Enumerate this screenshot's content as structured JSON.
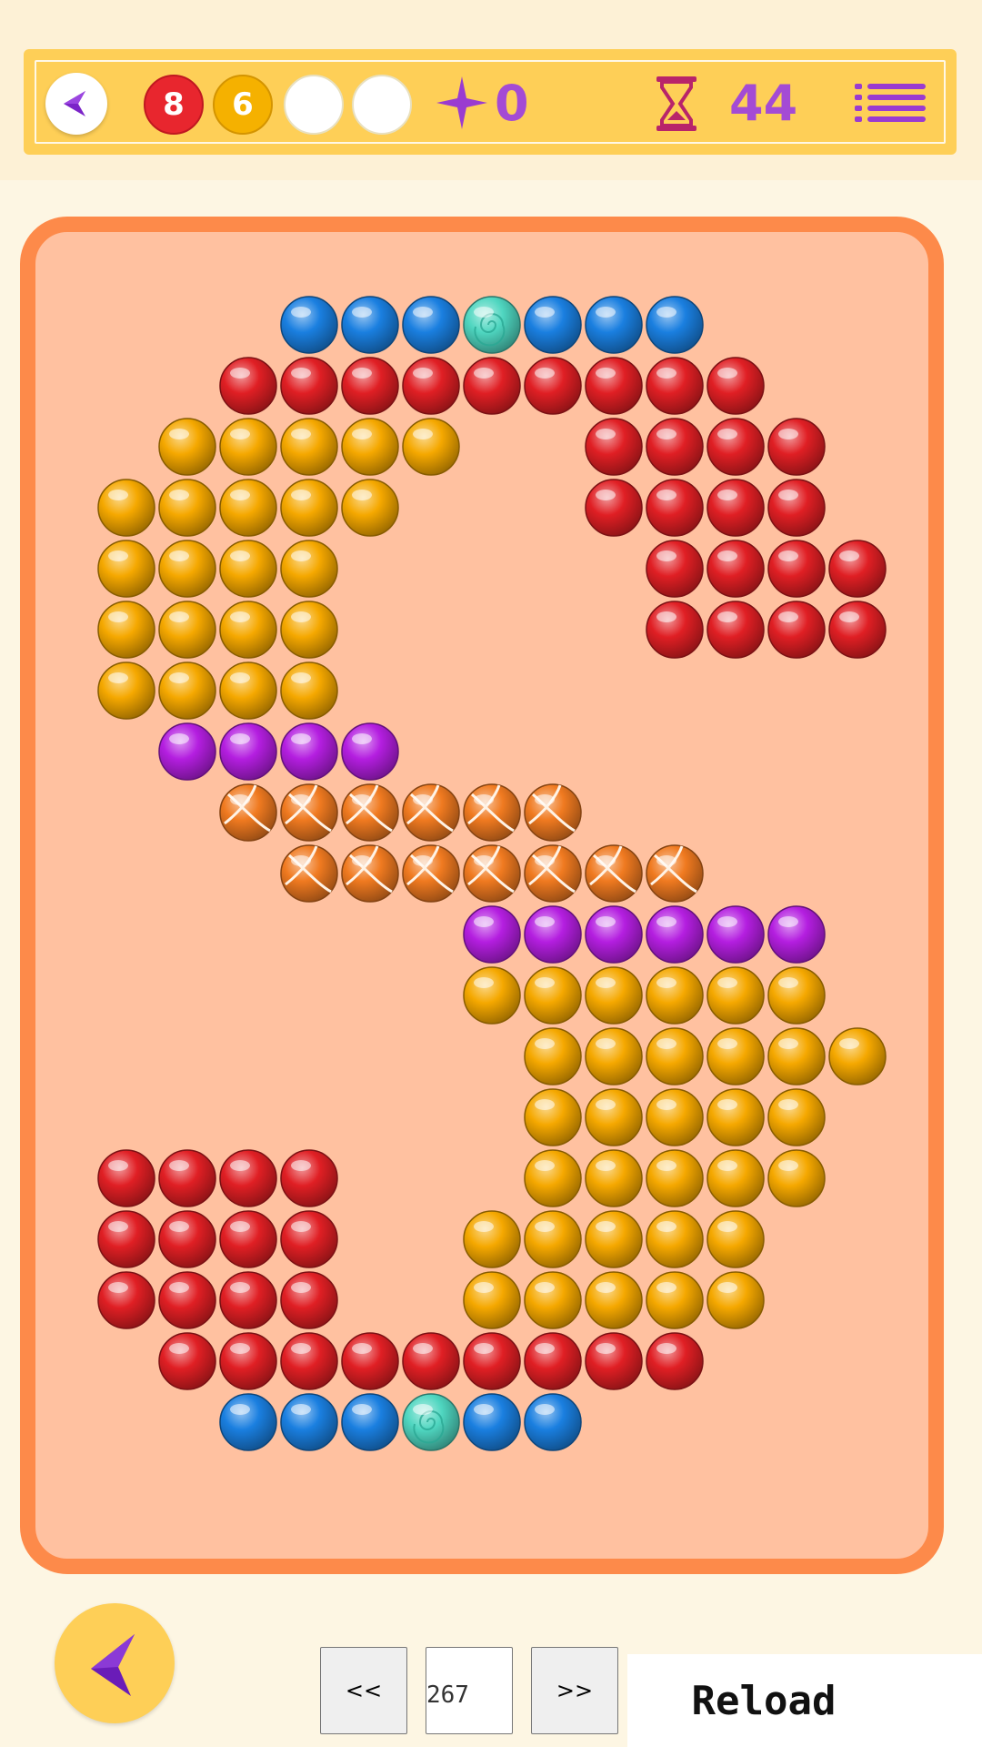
{
  "hud": {
    "back_icon": "chevron-left-icon",
    "counts": [
      {
        "value": "8",
        "color": "#e8262e"
      },
      {
        "value": "6",
        "color": "#f5b100"
      },
      {
        "value": "",
        "color": "#ffffff"
      },
      {
        "value": "",
        "color": "#ffffff"
      }
    ],
    "score_icon": "star-icon",
    "score": "0",
    "timer_icon": "hourglass-icon",
    "timer": "44",
    "menu_icon": "menu-icon",
    "text_color": "#a44bd4"
  },
  "board": {
    "border_color": "#fd8a4a",
    "background": "#ffc1a0",
    "rows": [
      [
        "",
        "",
        "",
        "",
        "B",
        "B",
        "B",
        "T",
        "B",
        "B",
        "B",
        "",
        "",
        "",
        ""
      ],
      [
        "",
        "",
        "",
        "R",
        "R",
        "R",
        "R",
        "R",
        "R",
        "R",
        "R",
        "R",
        "",
        ""
      ],
      [
        "",
        "",
        "Y",
        "Y",
        "Y",
        "Y",
        "Y",
        "",
        "",
        "R",
        "R",
        "R",
        "R",
        ""
      ],
      [
        "",
        "Y",
        "Y",
        "Y",
        "Y",
        "Y",
        "",
        "",
        "",
        "R",
        "R",
        "R",
        "R",
        ""
      ],
      [
        "",
        "Y",
        "Y",
        "Y",
        "Y",
        "",
        "",
        "",
        "",
        "",
        "R",
        "R",
        "R",
        "R"
      ],
      [
        "",
        "Y",
        "Y",
        "Y",
        "Y",
        "",
        "",
        "",
        "",
        "",
        "R",
        "R",
        "R",
        "R"
      ],
      [
        "",
        "Y",
        "Y",
        "Y",
        "Y",
        "",
        "",
        "",
        "",
        "",
        "",
        "",
        "",
        ""
      ],
      [
        "",
        "",
        "P",
        "P",
        "P",
        "P",
        "",
        "",
        "",
        "",
        "",
        "",
        "",
        ""
      ],
      [
        "",
        "",
        "",
        "O",
        "O",
        "O",
        "O",
        "O",
        "O",
        "",
        "",
        "",
        "",
        ""
      ],
      [
        "",
        "",
        "",
        "",
        "O",
        "O",
        "O",
        "O",
        "O",
        "O",
        "O",
        "",
        "",
        ""
      ],
      [
        "",
        "",
        "",
        "",
        "",
        "",
        "",
        "P",
        "P",
        "P",
        "P",
        "P",
        "P",
        ""
      ],
      [
        "",
        "",
        "",
        "",
        "",
        "",
        "",
        "Y",
        "Y",
        "Y",
        "Y",
        "Y",
        "Y",
        ""
      ],
      [
        "",
        "",
        "",
        "",
        "",
        "",
        "",
        "",
        "Y",
        "Y",
        "Y",
        "Y",
        "Y",
        "Y"
      ],
      [
        "",
        "",
        "",
        "",
        "",
        "",
        "",
        "",
        "Y",
        "Y",
        "Y",
        "Y",
        "Y",
        ""
      ],
      [
        "",
        "R",
        "R",
        "R",
        "R",
        "",
        "",
        "",
        "Y",
        "Y",
        "Y",
        "Y",
        "Y",
        ""
      ],
      [
        "",
        "R",
        "R",
        "R",
        "R",
        "",
        "",
        "Y",
        "Y",
        "Y",
        "Y",
        "Y",
        "",
        ""
      ],
      [
        "",
        "R",
        "R",
        "R",
        "R",
        "",
        "",
        "Y",
        "Y",
        "Y",
        "Y",
        "Y",
        "",
        ""
      ],
      [
        "",
        "",
        "R",
        "R",
        "R",
        "R",
        "R",
        "R",
        "R",
        "R",
        "R",
        "",
        "",
        ""
      ],
      [
        "",
        "",
        "",
        "B",
        "B",
        "B",
        "T",
        "B",
        "B",
        "",
        "",
        "",
        "",
        ""
      ]
    ],
    "legend": {
      "R": "red-ball",
      "Y": "yellow-ball",
      "B": "blue-ball",
      "P": "purple-ball",
      "O": "orange-striped-ball",
      "T": "teal-marble-ball"
    },
    "colors": {
      "R": "#e01f24",
      "Y": "#f5a800",
      "B": "#1a7fe0",
      "P": "#b41ee0",
      "O": "#f07a20",
      "T": "#4fd6c0"
    }
  },
  "footer": {
    "back_icon": "chevron-left-icon",
    "prev_label": "<<",
    "level_value": "267",
    "next_label": ">>",
    "reload_label": "Reload"
  }
}
